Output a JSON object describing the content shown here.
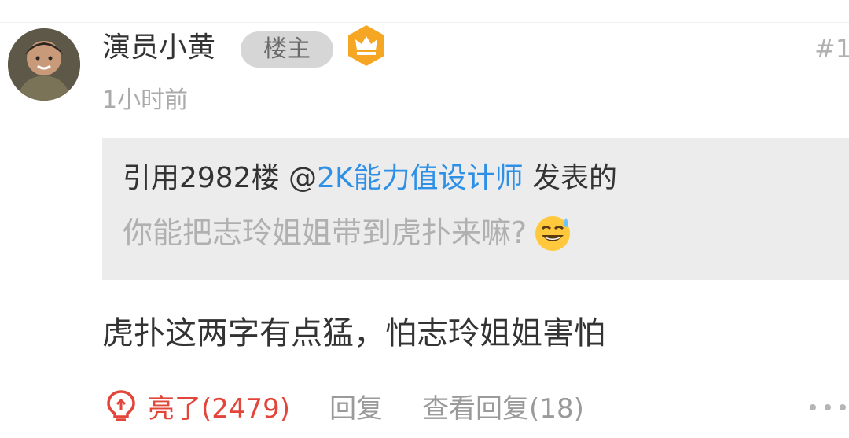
{
  "post": {
    "author": "演员小黄",
    "op_badge": "楼主",
    "floor": "#1",
    "time": "1小时前",
    "quote": {
      "prefix": "引用2982楼 @",
      "user": "2K能力值设计师",
      "suffix": " 发表的",
      "text": "你能把志玲姐姐带到虎扑来嘛?",
      "emoji": "sweat-smile-emoji"
    },
    "body": "虎扑这两字有点猛，怕志玲姐姐害怕",
    "actions": {
      "like_label": "亮了(2479)",
      "reply_label": "回复",
      "view_replies_label": "查看回复(18)"
    },
    "colors": {
      "link": "#2d8fe6",
      "like": "#e2453a",
      "badge_gold": "#f5a623"
    },
    "icons": [
      "crown-icon",
      "lightbulb-icon",
      "more-icon"
    ]
  }
}
